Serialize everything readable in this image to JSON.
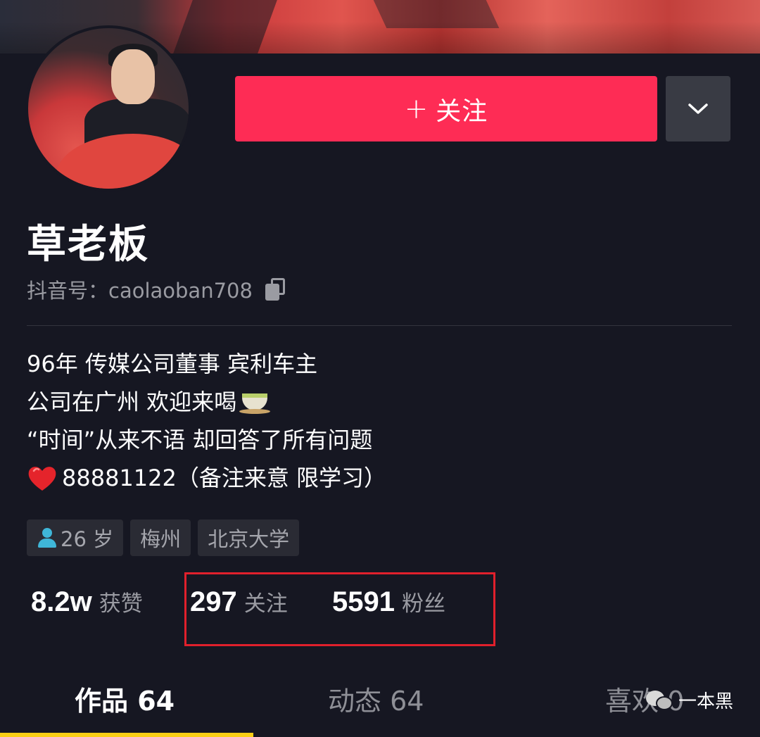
{
  "profile": {
    "name": "草老板",
    "douyin_id": "抖音号：caolaoban708"
  },
  "actions": {
    "follow_label": "关注",
    "follow_plus": "+"
  },
  "bio": {
    "line1": "96年 传媒公司董事 宾利车主",
    "line2": "公司在广州 欢迎来喝",
    "line3": "“时间”从来不语 却回答了所有问题",
    "line4": "88881122（备注来意 限学习）"
  },
  "tags": {
    "age": "26 岁",
    "city": "梅州",
    "school": "北京大学"
  },
  "stats": {
    "likes_num": "8.2w",
    "likes_label": "获赞",
    "following_num": "297",
    "following_label": "关注",
    "followers_num": "5591",
    "followers_label": "粉丝"
  },
  "tabs": {
    "works": "作品 64",
    "moments": "动态 64",
    "likes": "喜欢 0"
  },
  "watermark": {
    "text": "一本黑"
  },
  "colors": {
    "background": "#161722",
    "follow_button": "#fe2c55",
    "tab_indicator": "#face15",
    "highlight_box": "#e0202c"
  }
}
